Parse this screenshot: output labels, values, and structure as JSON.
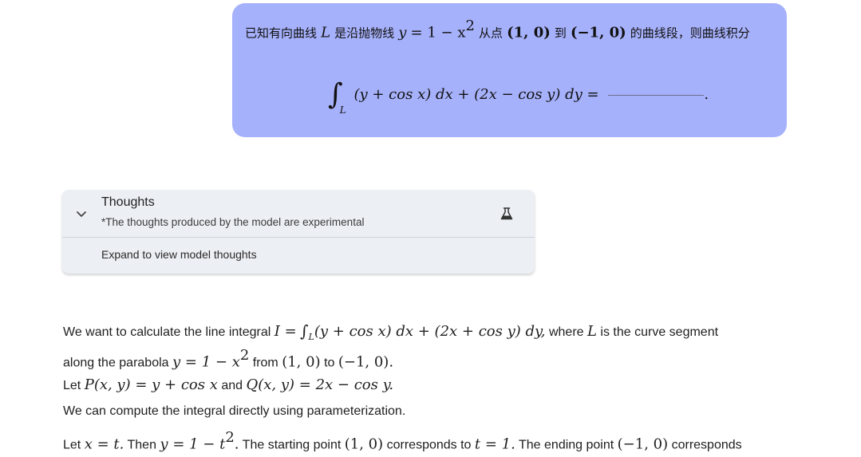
{
  "user_message": {
    "prefix_text": "已知有向曲线",
    "curve_symbol": "L",
    "middle_text": "是沿抛物线",
    "curve_eq_lhs": "y",
    "curve_eq_rhs": "= 1 − x",
    "curve_eq_power": "2",
    "from_text": "从点",
    "start_point": "(1, 0)",
    "to_text": "到",
    "end_point": "(−1, 0)",
    "suffix_text": "的曲线段，则曲线积分",
    "integral_symbol": "∫",
    "integral_subscript": "L",
    "integrand": "(y + cos x) dx + (2x − cos y) dy =",
    "period": "."
  },
  "thoughts": {
    "title": "Thoughts",
    "subtitle": "*The thoughts produced by the model are experimental",
    "expand_label": "Expand to view model thoughts",
    "chevron_icon": "chevron-down-icon",
    "experimental_icon": "flask-icon"
  },
  "response": {
    "line1": {
      "text_a": "We want to calculate the line integral",
      "math_a": "I =",
      "int_symbol": "∫",
      "int_sub": "L",
      "math_b": "(y + cos x) dx + (2x + cos y) dy,",
      "text_b": "where",
      "math_c": "L",
      "text_c": "is the curve segment"
    },
    "line2": {
      "text_a": "along the parabola",
      "math_a": "y = 1 − x",
      "power": "2",
      "text_b": "from",
      "math_b": "(1, 0)",
      "text_c": "to",
      "math_c": "(−1, 0)."
    },
    "line3": {
      "text_a": "Let",
      "math_a": "P(x, y) = y + cos x",
      "text_b": "and",
      "math_b": "Q(x, y) = 2x − cos y."
    },
    "line4": {
      "text_a": "We can compute the integral directly using parameterization."
    },
    "line5": {
      "text_a": "Let",
      "math_a": "x = t.",
      "text_b": "Then",
      "math_b": "y = 1 − t",
      "power": "2",
      "math_b_end": ".",
      "text_c": "The starting point",
      "math_c": "(1, 0)",
      "text_d": "corresponds to",
      "math_d": "t = 1.",
      "text_e": "The ending point",
      "math_e": "(−1, 0)",
      "text_f": "corresponds"
    }
  },
  "colors": {
    "bubble": "#a6b1fb",
    "card": "#eceff4",
    "text": "#1f1f1f"
  }
}
